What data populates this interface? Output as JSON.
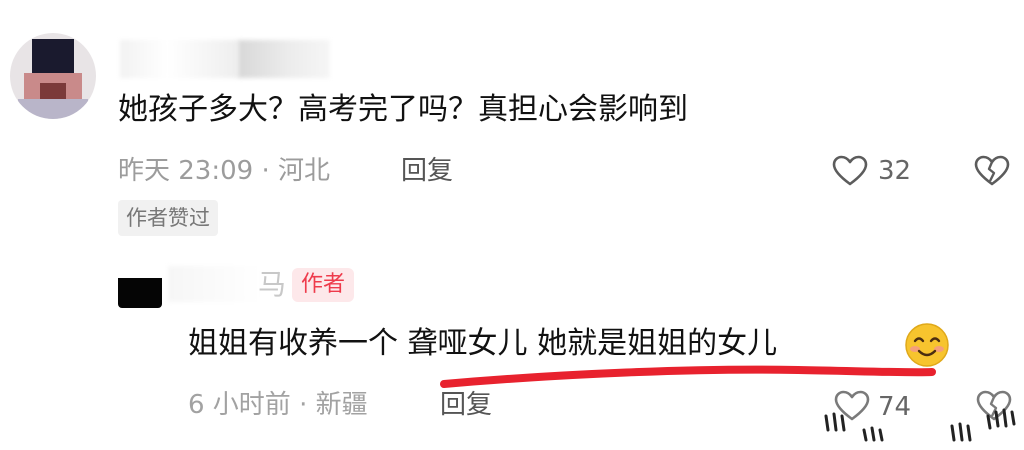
{
  "comment": {
    "text": "她孩子多大？高考完了吗？真担心会影响到",
    "meta": "昨天 23:09 · 河北",
    "reply_label": "回复",
    "like_count": "32",
    "author_liked_badge": "作者赞过"
  },
  "reply": {
    "name_partial": "马",
    "author_tag": "作者",
    "text": "姐姐有收养一个 聋哑女儿 她就是姐姐的女儿",
    "emoji": "smiling-face-emoji",
    "meta": "6 小时前 · 新疆",
    "reply_label": "回复",
    "like_count": "74"
  },
  "colors": {
    "text": "#111111",
    "meta": "#9c9c9c",
    "author_tag_bg": "#fde8ea",
    "author_tag_text": "#ee3b4c",
    "underline": "#e8222e"
  },
  "icons": {
    "like": "heart-outline-icon",
    "dislike": "broken-heart-icon"
  }
}
